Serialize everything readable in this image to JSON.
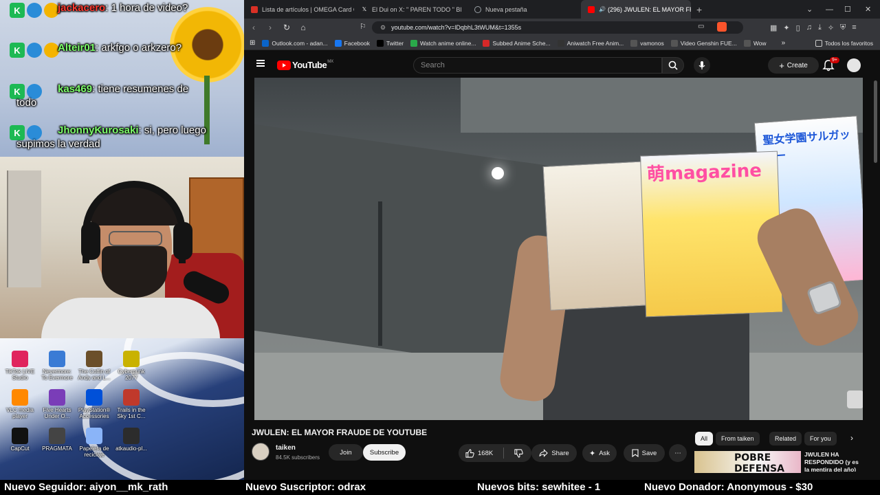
{
  "chat": {
    "messages": [
      {
        "user": "jackacero",
        "text": ": 1 hora de video?"
      },
      {
        "user": "Alteir01",
        "text": ": arkfgo o arkzero?"
      },
      {
        "user": "kas469",
        "text": ": tiene resumenes de todo"
      },
      {
        "user": "JhonnyKurosaki",
        "text": ": si, pero luego supimos la verdad"
      }
    ]
  },
  "desktop": {
    "icons": [
      {
        "label": "TikTok LIVE Studio",
        "icon": "tiktok-icon",
        "color": "#e0245e"
      },
      {
        "label": "Nevermore: To Evermore",
        "icon": "game-icon",
        "color": "#3a7bd5"
      },
      {
        "label": "The Coffin of Andy and L...",
        "icon": "game-icon",
        "color": "#6b4f2a"
      },
      {
        "label": "Cyberpunk 2077",
        "icon": "game-icon",
        "color": "#c9b200"
      },
      {
        "label": "VLC media player",
        "icon": "vlc-icon",
        "color": "#ff8800"
      },
      {
        "label": "Five Hearts Under O...",
        "icon": "game-icon",
        "color": "#7a3db8"
      },
      {
        "label": "PlayStation® Accessories",
        "icon": "playstation-icon",
        "color": "#0050d8"
      },
      {
        "label": "Trails in the Sky 1st C...",
        "icon": "game-icon",
        "color": "#c0392b"
      },
      {
        "label": "CapCut",
        "icon": "capcut-icon",
        "color": "#111111"
      },
      {
        "label": "PRAGMATA",
        "icon": "game-icon",
        "color": "#444444"
      },
      {
        "label": "Papelera de reciclaje",
        "icon": "recycle-bin-icon",
        "color": "#8ab4f8"
      },
      {
        "label": "atkaudio-pl...",
        "icon": "audio-icon",
        "color": "#2c2c2c"
      }
    ]
  },
  "browser": {
    "tabs": [
      {
        "title": "Lista de artículos | OMEGA Card Gam",
        "favicon_color": "#d93025",
        "active": false
      },
      {
        "title": "El Dui on X: \" PAREN TODO \" Bl",
        "favicon_color": "#000000",
        "active": false
      },
      {
        "title": "Nueva pestaña",
        "favicon_color": "#9aa0a6",
        "active": false
      },
      {
        "title": "(296) JWULEN: EL MAYOR FR/",
        "favicon_color": "#ff0000",
        "active": true
      }
    ],
    "url": "youtube.com/watch?v=lDqbhL3tWUM&t=1355s",
    "bookmarks": [
      {
        "label": "Outlook.com - adan...",
        "color": "#0a64c8"
      },
      {
        "label": "Facebook",
        "color": "#1877f2"
      },
      {
        "label": "Twitter",
        "color": "#000000"
      },
      {
        "label": "Watch anime online...",
        "color": "#2aa94a"
      },
      {
        "label": "Subbed Anime Sche...",
        "color": "#d62828"
      },
      {
        "label": "Aniwatch Free Anim...",
        "color": "#333333"
      },
      {
        "label": "vamonos",
        "color": "#555555"
      },
      {
        "label": "Video Genshin FUE...",
        "color": "#555555"
      },
      {
        "label": "Wow",
        "color": "#555555"
      }
    ],
    "all_bookmarks": "Todos los favoritos"
  },
  "youtube": {
    "logo_text": "YouTube",
    "region": "MX",
    "search_placeholder": "Search",
    "create_label": "Create",
    "notifications_badge": "9+",
    "video_title": "JWULEN: EL MAYOR FRAUDE DE YOUTUBE",
    "channel_name": "taiken",
    "subscribers": "84.5K subscribers",
    "join_label": "Join",
    "subscribe_label": "Subscribe",
    "likes": "168K",
    "share_label": "Share",
    "ask_label": "Ask",
    "save_label": "Save",
    "chips": [
      "All",
      "From taiken",
      "Related",
      "For you"
    ],
    "rec_thumb_text": "POBRE DEFENSA",
    "rec_title": "JWULEN HA RESPONDIDO (y es la mentira del año)",
    "video_text": {
      "magazine": "萌magazine",
      "magazine2": "聖女学園サルガッソー"
    }
  },
  "ticker": {
    "follower": "Nuevo Seguidor: aiyon__mk_rath",
    "subscriber": "Nuevo Suscriptor: odrax",
    "bits": "Nuevos bits: sewhitee - 1",
    "donor": "Nuevo Donador: Anonymous - $30"
  }
}
